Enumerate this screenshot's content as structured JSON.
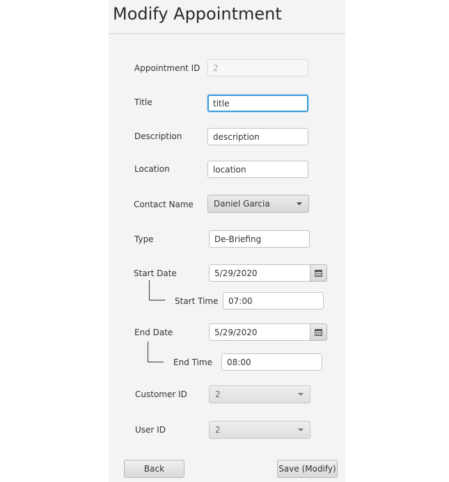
{
  "window": {
    "title": "Modify Appointment"
  },
  "form": {
    "appointment_id": {
      "label": "Appointment ID",
      "value": "2"
    },
    "title": {
      "label": "Title",
      "value": "title"
    },
    "description": {
      "label": "Description",
      "value": "description"
    },
    "location": {
      "label": "Location",
      "value": "location"
    },
    "contact_name": {
      "label": "Contact Name",
      "selected": "Daniel Garcia"
    },
    "type": {
      "label": "Type",
      "value": "De-Briefing"
    },
    "start_date": {
      "label": "Start Date",
      "value": "5/29/2020"
    },
    "start_time": {
      "label": "Start Time",
      "value": "07:00"
    },
    "end_date": {
      "label": "End Date",
      "value": "5/29/2020"
    },
    "end_time": {
      "label": "End Time",
      "value": "08:00"
    },
    "customer_id": {
      "label": "Customer ID",
      "selected": "2"
    },
    "user_id": {
      "label": "User ID",
      "selected": "2"
    }
  },
  "buttons": {
    "back": "Back",
    "save": "Save (Modify)"
  },
  "colors": {
    "focus_accent": "#3c9ad6",
    "background": "#f4f4f4"
  }
}
